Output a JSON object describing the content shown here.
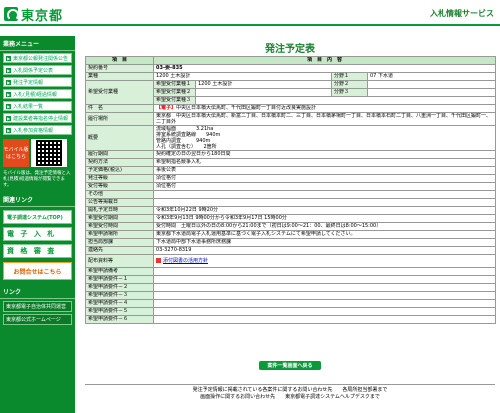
{
  "header": {
    "logo_text": "東京都",
    "service_title": "入札情報サービス"
  },
  "sidebar": {
    "menu_head": "業務メニュー",
    "items": [
      "東京都公報発注関係公告",
      "入札関係予定公表",
      "発注予定情報",
      "入札(見積)経過情報",
      "入札結果一覧",
      "建設業者等指名停止情報",
      "入札参加資格情報"
    ],
    "mobile_label": "モバイル版",
    "mobile_sub": "はこちら",
    "mobile_desc": "モバイル版は、発注予定情報と入札(見積)経過情報が閲覧できます。",
    "link_head": "関連リンク",
    "big_buttons": [
      "電子調達システム(TOP)",
      "電 子 入 札",
      "資 格 審 査"
    ],
    "help_label": "お問合せはこちら",
    "help_sub": "電子調達ヘルプデスク",
    "links_head": "リンク",
    "links": [
      "東京都電子自治体共同運営",
      "東京都公式ホームページ"
    ]
  },
  "main": {
    "title": "発注予定表",
    "col_item": "項　目",
    "col_content": "項　目　内　容",
    "rows": {
      "contract_no_label": "契約番号",
      "contract_no": "03-委-835",
      "business_label": "業種",
      "business": "1200 土木設計",
      "category_label": "分野１",
      "category": "07 下水道",
      "desired_label": "希望受付業種",
      "d1_label": "希望受付業種１",
      "d1": "1200 土木設計",
      "d2_label": "希望受付業種２",
      "d3_label": "希望受付業種３",
      "f2_label": "分野２",
      "f3_label": "分野３",
      "name_label": "件　名",
      "name_tag": "【電子】",
      "name": "中央区日本橋大伝馬町、千代田区鍛町一丁目付近改良実施設計",
      "place_label": "履行場所",
      "place": "東京都　中央区日本橋大伝馬町、新富二丁目、日本橋本町二、三丁目、日本橋茅場町一丁目、日本橋本石町二丁目、八重洲一丁目、千代田区鍛町一、二丁目外",
      "summary_label": "概要",
      "summary": [
        "流域幅面　　　　3.21ha",
        "排室系統調査路線　　940m",
        "管路内調査　　　940m",
        "人孔（調査含む）　　2箇所"
      ],
      "period_label": "履行期間",
      "period": "契約確定の日の翌日から180日間",
      "method_label": "契約方法",
      "method": "希望制指名競争入札",
      "price_label": "予定価格(税込)",
      "price": "事後公表",
      "place2_label": "発注等級",
      "place2": "須位格付",
      "rank_label": "受付等級",
      "rank": "須位格付",
      "other_label": "その他",
      "other": "",
      "announce_label": "公告等掲載日",
      "announce": "",
      "open_label": "開札予定日時",
      "open": "令和3年10月22日 9時20分",
      "accept_label": "希望受付期間",
      "accept": "令和3年9月13日 9時00分から令和3年9月17日 15時00分",
      "accept_time_label": "希望受付時間",
      "accept_time": "受付時間　土曜日以外の日の8:00から21:00まで（初日は9:00〜21：00、最終日は8:00〜15:00）",
      "accept_way_label": "希望申請場所",
      "accept_way": "東京都下水道局電子入札運用基準に基づく電子入札システムにて希望申請してください。",
      "dept_label": "担当局部課",
      "dept": "下水道局中部下水道事務所庶務課",
      "contact_label": "連絡先",
      "contact": "03-3270-8319",
      "docs_label": "配布資料等",
      "docs": "添付図書の活用方針",
      "app_label": "希望申請備考",
      "app1_label": "希望申請要件－１",
      "app2_label": "希望申請要件－２",
      "app3_label": "希望申請要件－３",
      "app4_label": "希望申請要件－４",
      "app5_label": "希望申請要件－５",
      "app6_label": "希望申請要件－６"
    },
    "back_button": "案件一覧画面へ戻る"
  },
  "footer": {
    "line1": "発注予定情報に掲載されている各案件に関するお問い合わせ先　　各局所担当部署まで",
    "line2": "画面操作に関するお問い合わせ先　　東京都電子調達システムヘルプデスクまで"
  },
  "colors": {
    "brand_green": "#0a9a3a",
    "sidebar_green": "#0b8a2d",
    "header_cell": "#c6e7c6",
    "label_cell": "#d8efd8"
  }
}
